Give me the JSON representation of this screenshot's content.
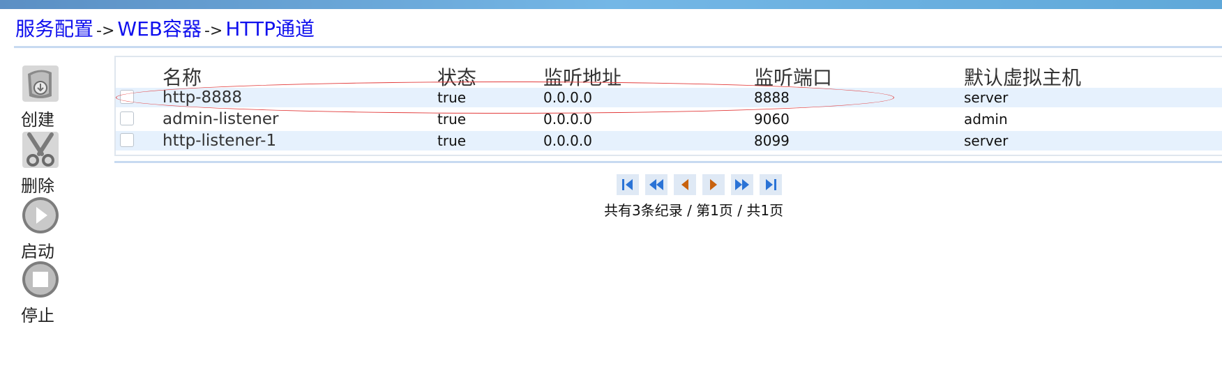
{
  "breadcrumb": {
    "item1": "服务配置",
    "item2": "WEB容器",
    "item3": "HTTP通道",
    "separator": "->"
  },
  "toolbar": {
    "create": {
      "label": "创建",
      "icon": "create-icon"
    },
    "delete": {
      "label": "删除",
      "icon": "scissors-icon"
    },
    "start": {
      "label": "启动",
      "icon": "play-icon"
    },
    "stop": {
      "label": "停止",
      "icon": "stop-icon"
    }
  },
  "table": {
    "headers": {
      "name": "名称",
      "status": "状态",
      "address": "监听地址",
      "port": "监听端口",
      "vhost": "默认虚拟主机"
    },
    "rows": [
      {
        "name": "http-8888",
        "status": "true",
        "address": "0.0.0.0",
        "port": "8888",
        "vhost": "server"
      },
      {
        "name": "admin-listener",
        "status": "true",
        "address": "0.0.0.0",
        "port": "9060",
        "vhost": "admin"
      },
      {
        "name": "http-listener-1",
        "status": "true",
        "address": "0.0.0.0",
        "port": "8099",
        "vhost": "server"
      }
    ]
  },
  "pager": {
    "info": "共有3条纪录 / 第1页 / 共1页",
    "icons": [
      "first-page-icon",
      "prev-fast-icon",
      "prev-page-icon",
      "next-page-icon",
      "next-fast-icon",
      "last-page-icon"
    ]
  },
  "colors": {
    "link": "#1010ee",
    "row_alt": "#e6f1fd",
    "highlight_oval": "#e23b3b",
    "pager_blue": "#2a73d6",
    "pager_orange": "#c8620e"
  }
}
